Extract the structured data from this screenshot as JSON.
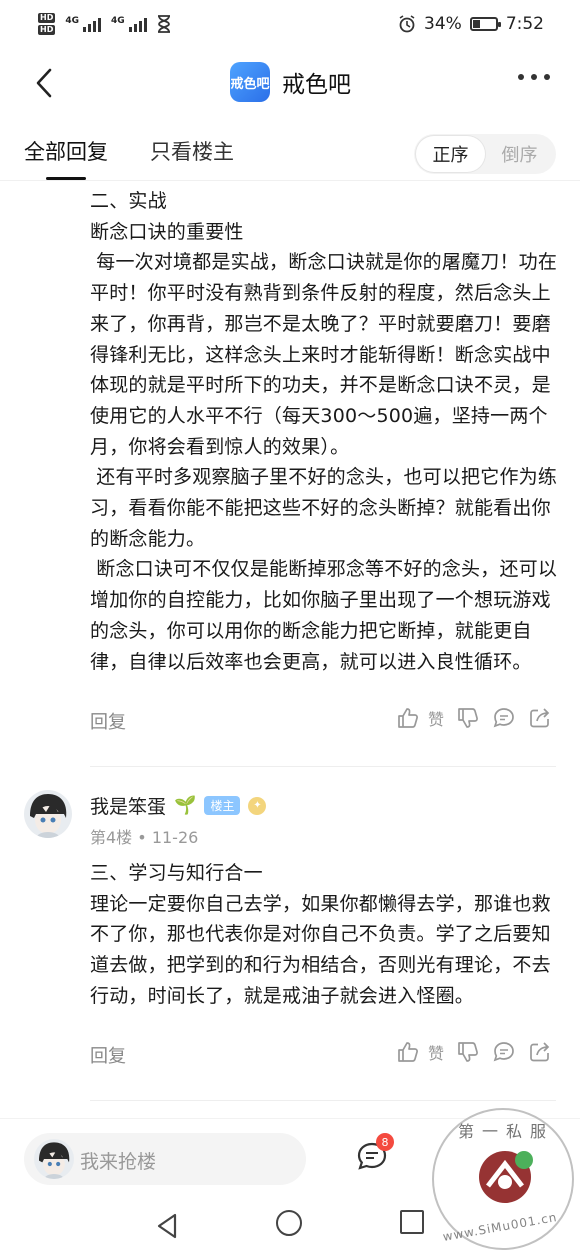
{
  "status_bar": {
    "sim1": "HD",
    "sim2": "HD",
    "net1": "4G",
    "net2": "4G",
    "battery_pct": "34%",
    "battery_level": 0.34,
    "time": "7:52"
  },
  "header": {
    "logo_text": "戒色吧",
    "title": "戒色吧"
  },
  "tabs": {
    "all_replies": "全部回复",
    "only_op": "只看楼主",
    "sort_asc": "正序",
    "sort_desc": "倒序"
  },
  "post1": {
    "body": "二、实战\n断念口诀的重要性\n 每一次对境都是实战，断念口诀就是你的屠魔刀！功在平时！你平时没有熟背到条件反射的程度，然后念头上来了，你再背，那岂不是太晚了？平时就要磨刀！要磨得锋利无比，这样念头上来时才能斩得断！断念实战中体现的就是平时所下的功夫，并不是断念口诀不灵，是使用它的人水平不行（每天300～500遍，坚持一两个月，你将会看到惊人的效果）。\n 还有平时多观察脑子里不好的念头，也可以把它作为练习，看看你能不能把这些不好的念头断掉？就能看出你的断念能力。\n 断念口诀可不仅仅是能断掉邪念等不好的念头，还可以增加你的自控能力，比如你脑子里出现了一个想玩游戏的念头，你可以用你的断念能力把它断掉，就能更自律，自律以后效率也会更高，就可以进入良性循环。",
    "reply_label": "回复",
    "zan_label": "赞"
  },
  "post2": {
    "author": "我是笨蛋",
    "sprout": "🌱",
    "op_badge": "楼主",
    "floor": "第4楼",
    "date": "11-26",
    "body": "三、学习与知行合一\n理论一定要你自己去学，如果你都懒得去学，那谁也救不了你，那也代表你是对你自己不负责。学了之后要知道去做，把学到的和行为相结合，否则光有理论，不去行动，时间长了，就是戒油子就会进入怪圈。",
    "reply_label": "回复",
    "zan_label": "赞"
  },
  "bottom_bar": {
    "input_placeholder": "我来抢楼",
    "comment_count": "8"
  },
  "watermark": {
    "top_text": "第一私服",
    "bottom_text": "www.SiMu001.cn"
  }
}
